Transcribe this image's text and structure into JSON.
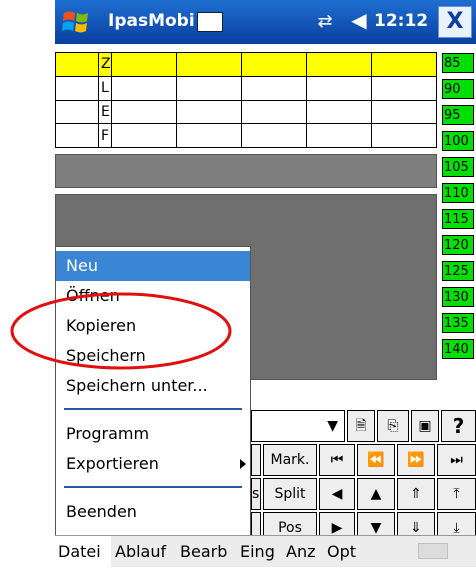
{
  "title_bar": {
    "app_title": "IpasMobi",
    "time": "12:12",
    "close_label": "X"
  },
  "grid": {
    "rows": [
      {
        "key": "Z",
        "highlight": true
      },
      {
        "key": "L",
        "highlight": false
      },
      {
        "key": "E",
        "highlight": false
      },
      {
        "key": "F",
        "highlight": false
      }
    ]
  },
  "scale": [
    "85",
    "90",
    "95",
    "100",
    "105",
    "110",
    "115",
    "120",
    "125",
    "130",
    "135",
    "140"
  ],
  "toolbar": {
    "row2": [
      "Mark.",
      "Split",
      "Pos"
    ],
    "partial_s": "s"
  },
  "file_menu": {
    "items": [
      "Neu",
      "Öffnen",
      "Kopieren",
      "Speichern",
      "Speichern unter...",
      "Programm",
      "Exportieren",
      "Beenden"
    ],
    "selected": "Neu"
  },
  "menubar": [
    "Datei",
    "Ablauf",
    "Bearb",
    "Eing",
    "Anz",
    "Opt"
  ],
  "colors": {
    "titlebar": "#0a3f9e",
    "highlight_row": "#ffff00",
    "scale": "#00e000",
    "menu_selected": "#3b86d4",
    "annotation": "#e01010"
  }
}
